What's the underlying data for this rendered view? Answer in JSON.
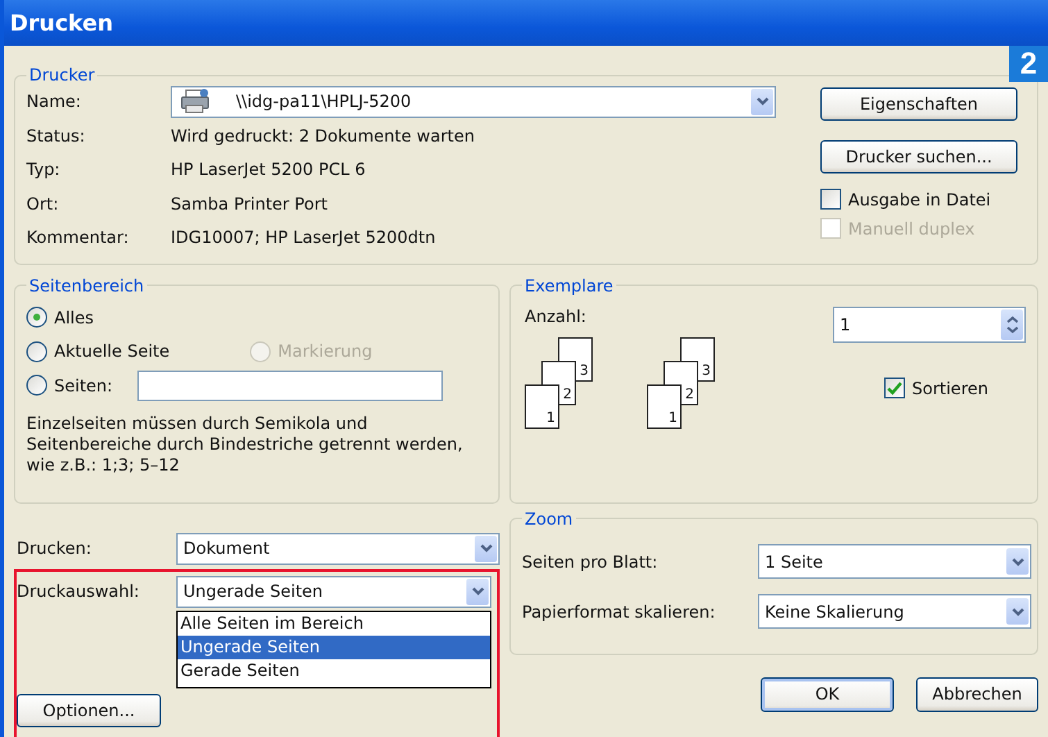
{
  "window": {
    "title": "Drucken"
  },
  "badge": "2",
  "printer": {
    "legend": "Drucker",
    "name_label": "Name:",
    "name_value": "\\\\idg-pa11\\HPLJ-5200",
    "info": [
      {
        "label": "Status:",
        "value": "Wird gedruckt: 2 Dokumente warten"
      },
      {
        "label": "Typ:",
        "value": "HP LaserJet 5200 PCL 6"
      },
      {
        "label": "Ort:",
        "value": "Samba Printer Port"
      },
      {
        "label": "Kommentar:",
        "value": "IDG10007; HP LaserJet 5200dtn"
      }
    ],
    "buttons": [
      "Eigenschaften",
      "Drucker suchen..."
    ],
    "checkboxes": [
      {
        "label": "Ausgabe in Datei",
        "checked": false,
        "disabled": false
      },
      {
        "label": "Manuell duplex",
        "checked": false,
        "disabled": true
      }
    ]
  },
  "page_range": {
    "legend": "Seitenbereich",
    "rows": [
      [
        {
          "label": "Alles",
          "selected": true,
          "disabled": false,
          "kind": "radio"
        }
      ],
      [
        {
          "label": "Aktuelle Seite",
          "selected": false,
          "disabled": false,
          "kind": "radio"
        },
        {
          "label": "Markierung",
          "selected": false,
          "disabled": true,
          "kind": "radio"
        }
      ],
      [
        {
          "label": "Seiten:",
          "selected": false,
          "disabled": false,
          "kind": "radio_field"
        }
      ]
    ],
    "hint": "Einzelseiten müssen durch Semikola und Seitenbereiche durch Bindestriche getrennt werden, wie z.B.: 1;3; 5–12"
  },
  "copies": {
    "legend": "Exemplare",
    "count_label": "Anzahl:",
    "count_value": "1",
    "stacks": [
      [
        "3",
        "2",
        "1"
      ],
      [
        "3",
        "2",
        "1"
      ]
    ],
    "collate": {
      "label": "Sortieren",
      "checked": true
    }
  },
  "print_what": {
    "label": "Drucken:",
    "value": "Dokument"
  },
  "print_selection": {
    "label": "Druckauswahl:",
    "value": "Ungerade Seiten",
    "expanded": true,
    "options": [
      {
        "label": "Alle Seiten im Bereich",
        "selected": false
      },
      {
        "label": "Ungerade Seiten",
        "selected": true
      },
      {
        "label": "Gerade Seiten",
        "selected": false
      }
    ]
  },
  "options_button": "Optionen...",
  "zoom": {
    "legend": "Zoom",
    "rows": [
      {
        "label": "Seiten pro Blatt:",
        "value": "1 Seite"
      },
      {
        "label": "Papierformat skalieren:",
        "value": "Keine Skalierung"
      }
    ]
  },
  "footer_buttons": [
    "OK",
    "Abbrechen"
  ]
}
